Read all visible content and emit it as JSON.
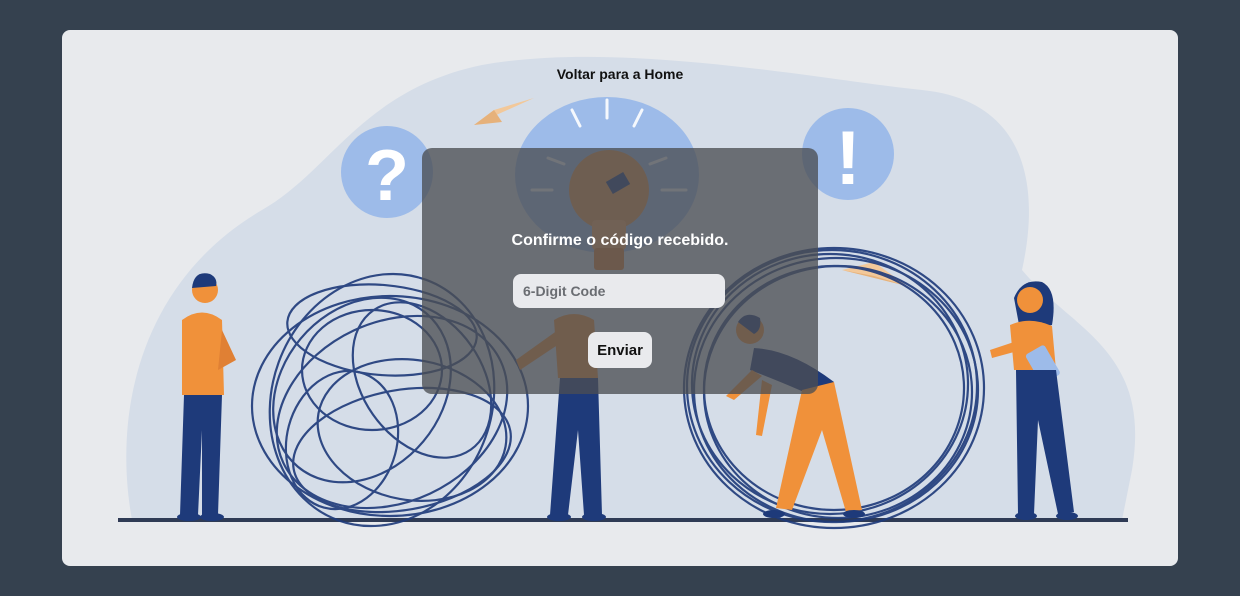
{
  "nav": {
    "home_link": "Voltar para a Home"
  },
  "verification": {
    "title": "Confirme o código recebido.",
    "code_placeholder": "6-Digit Code",
    "code_value": "",
    "submit_label": "Enviar"
  },
  "illustration": {
    "icons": [
      "question-mark-icon",
      "lightbulb-icon",
      "exclamation-mark-icon",
      "paper-plane-icon"
    ],
    "colors": {
      "page_background": "#35414f",
      "card_background": "#e8eaed",
      "blob": "#d5dde8",
      "accent_blue": "#9dbbe9",
      "navy": "#1e3a7a",
      "orange": "#f0913a"
    },
    "question_glyph": "?",
    "exclamation_glyph": "!"
  }
}
